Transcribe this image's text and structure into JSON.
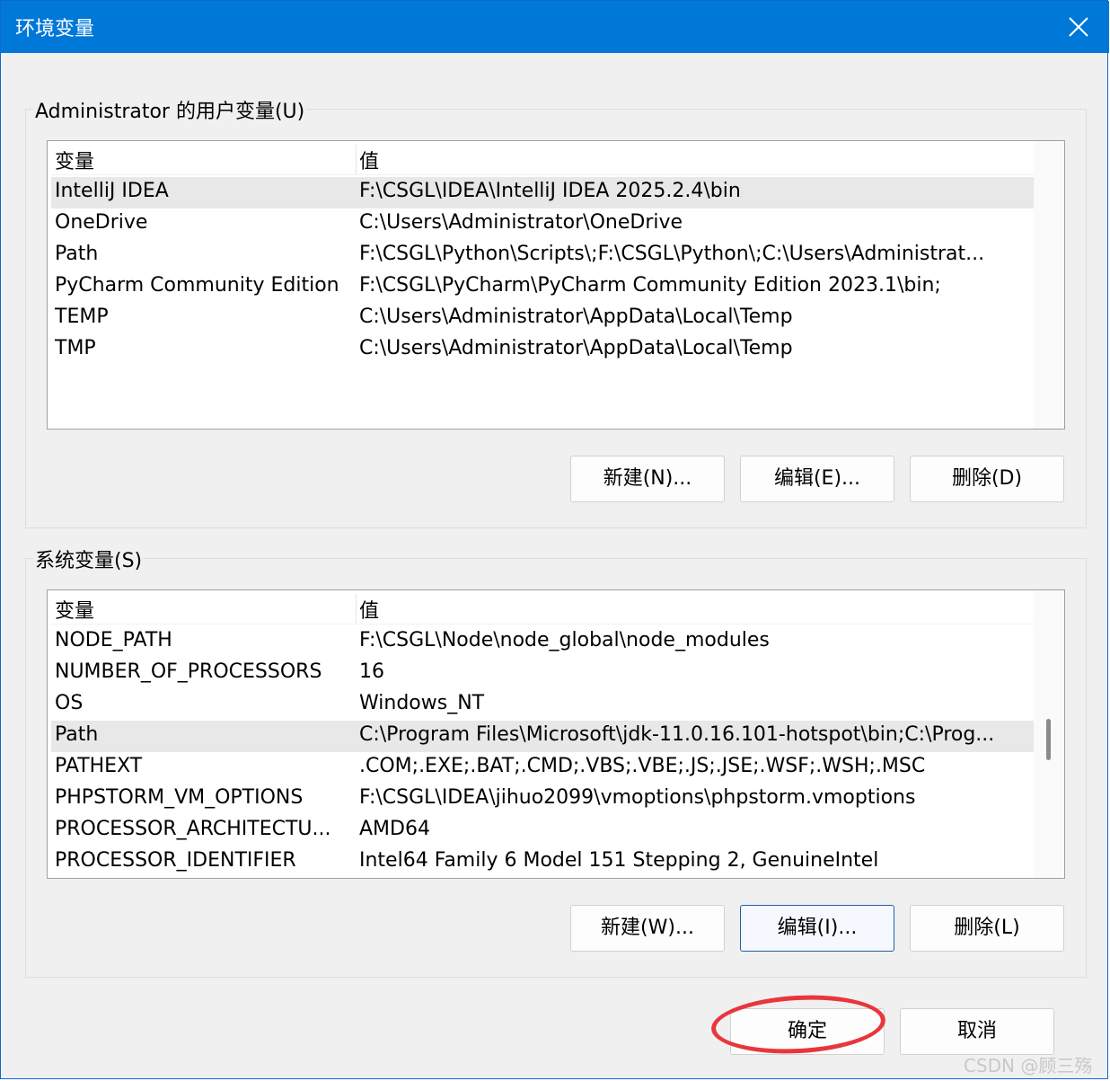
{
  "window": {
    "title": "环境变量"
  },
  "user_vars": {
    "group_label": "Administrator 的用户变量(U)",
    "header": {
      "name": "变量",
      "value": "值"
    },
    "rows": [
      {
        "name": "IntelliJ IDEA",
        "value": "F:\\CSGL\\IDEA\\IntelliJ IDEA 2025.2.4\\bin",
        "selected": true
      },
      {
        "name": "OneDrive",
        "value": "C:\\Users\\Administrator\\OneDrive"
      },
      {
        "name": "Path",
        "value": "F:\\CSGL\\Python\\Scripts\\;F:\\CSGL\\Python\\;C:\\Users\\Administrat..."
      },
      {
        "name": "PyCharm Community Edition",
        "value": "F:\\CSGL\\PyCharm\\PyCharm Community Edition 2023.1\\bin;"
      },
      {
        "name": "TEMP",
        "value": "C:\\Users\\Administrator\\AppData\\Local\\Temp"
      },
      {
        "name": "TMP",
        "value": "C:\\Users\\Administrator\\AppData\\Local\\Temp"
      }
    ],
    "buttons": {
      "new": "新建(N)...",
      "edit": "编辑(E)...",
      "delete": "删除(D)"
    }
  },
  "system_vars": {
    "group_label": "系统变量(S)",
    "header": {
      "name": "变量",
      "value": "值"
    },
    "rows": [
      {
        "name": "NODE_PATH",
        "value": "F:\\CSGL\\Node\\node_global\\node_modules"
      },
      {
        "name": "NUMBER_OF_PROCESSORS",
        "value": "16"
      },
      {
        "name": "OS",
        "value": "Windows_NT"
      },
      {
        "name": "Path",
        "value": "C:\\Program Files\\Microsoft\\jdk-11.0.16.101-hotspot\\bin;C:\\Prog...",
        "selected": true
      },
      {
        "name": "PATHEXT",
        "value": ".COM;.EXE;.BAT;.CMD;.VBS;.VBE;.JS;.JSE;.WSF;.WSH;.MSC"
      },
      {
        "name": "PHPSTORM_VM_OPTIONS",
        "value": "F:\\CSGL\\IDEA\\jihuo2099\\vmoptions\\phpstorm.vmoptions"
      },
      {
        "name": "PROCESSOR_ARCHITECTU...",
        "value": "AMD64"
      },
      {
        "name": "PROCESSOR_IDENTIFIER",
        "value": "Intel64 Family 6 Model 151 Stepping 2, GenuineIntel"
      }
    ],
    "buttons": {
      "new": "新建(W)...",
      "edit": "编辑(I)...",
      "delete": "删除(L)"
    }
  },
  "footer": {
    "ok": "确定",
    "cancel": "取消"
  },
  "watermark": "CSDN @顾三殇",
  "colors": {
    "titlebar": "#0078d7",
    "annotation": "#e8363b",
    "selected_row": "#e8e8e8"
  },
  "icons": {
    "close": "close-icon"
  }
}
